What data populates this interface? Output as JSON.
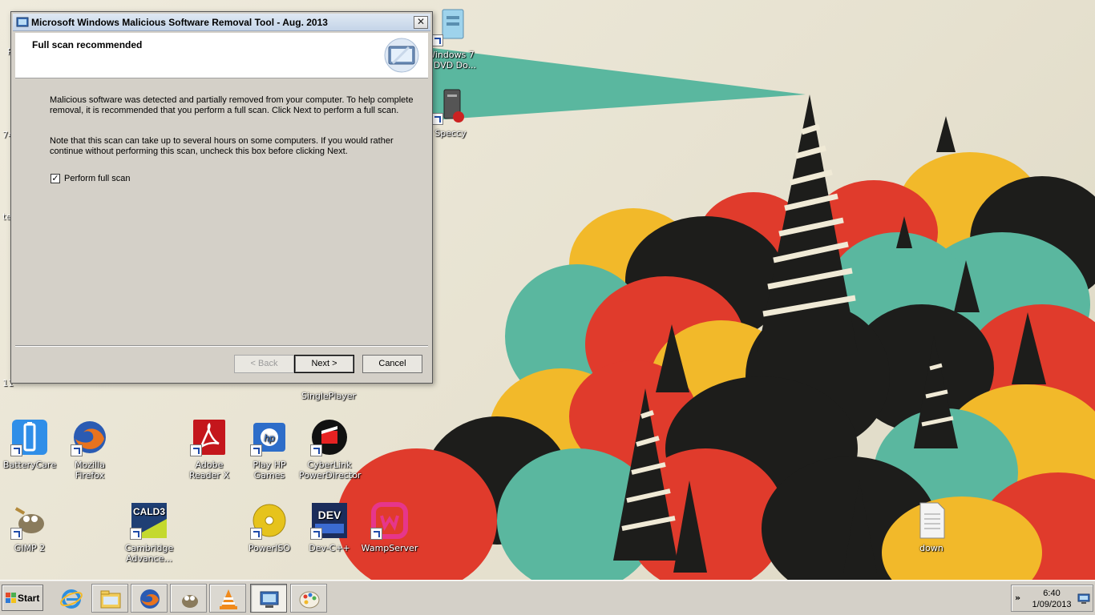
{
  "dialog": {
    "title": "Microsoft Windows Malicious Software Removal Tool - Aug. 2013",
    "close_label": "✕",
    "header_title": "Full scan recommended",
    "paragraph1": "Malicious software was detected and partially removed from your computer. To help complete removal, it is recommended that you perform a full scan. Click Next to perform a full scan.",
    "paragraph2": "Note that this scan can take up to several hours on some computers. If you would rather continue without performing this scan, uncheck this box before clicking Next.",
    "checkbox_label": "Perform full scan",
    "checkbox_checked": true,
    "checkbox_mark": "✓",
    "buttons": {
      "back": "< Back",
      "next": "Next >",
      "cancel": "Cancel"
    }
  },
  "desktop": {
    "icons": [
      {
        "label": "Windows 7\nB DVD Do...",
        "icon": "dvd-tool-icon"
      },
      {
        "label": "Speccy",
        "icon": "speccy-icon"
      },
      {
        "label": "SinglePlayer",
        "icon": "game-icon"
      },
      {
        "label": "BatteryCare",
        "icon": "battery-icon"
      },
      {
        "label": "Mozilla Firefox",
        "icon": "firefox-icon"
      },
      {
        "label": "Adobe Reader X",
        "icon": "adobe-reader-icon"
      },
      {
        "label": "Play HP Games",
        "icon": "hp-games-icon"
      },
      {
        "label": "CyberLink PowerDirector",
        "icon": "powerdirector-icon"
      },
      {
        "label": "GIMP 2",
        "icon": "gimp-icon"
      },
      {
        "label": "Cambridge Advance...",
        "icon": "cald3-icon"
      },
      {
        "label": "PowerISO",
        "icon": "poweriso-icon"
      },
      {
        "label": "Dev-C++",
        "icon": "devcpp-icon"
      },
      {
        "label": "WampServer",
        "icon": "wampserver-icon"
      },
      {
        "label": "down",
        "icon": "text-file-icon"
      }
    ],
    "edge_texts": [
      "R",
      "74",
      "ter",
      "11"
    ],
    "cald3_badge": "CALD3",
    "dev_badge": "DEV"
  },
  "taskbar": {
    "start_label": "Start",
    "buttons": [
      "internet-explorer-icon",
      "explorer-icon",
      "firefox-icon",
      "gimp-icon",
      "vlc-icon",
      "msrt-icon",
      "paint-icon"
    ],
    "tray_chevron": "»",
    "clock_time": "6:40",
    "clock_date": "1/09/2013"
  },
  "colors": {
    "teal": "#5ab79f",
    "red": "#e03b2c",
    "yellow": "#f2b92a",
    "black": "#1d1d1b",
    "taskbar": "#d4d0c8"
  }
}
